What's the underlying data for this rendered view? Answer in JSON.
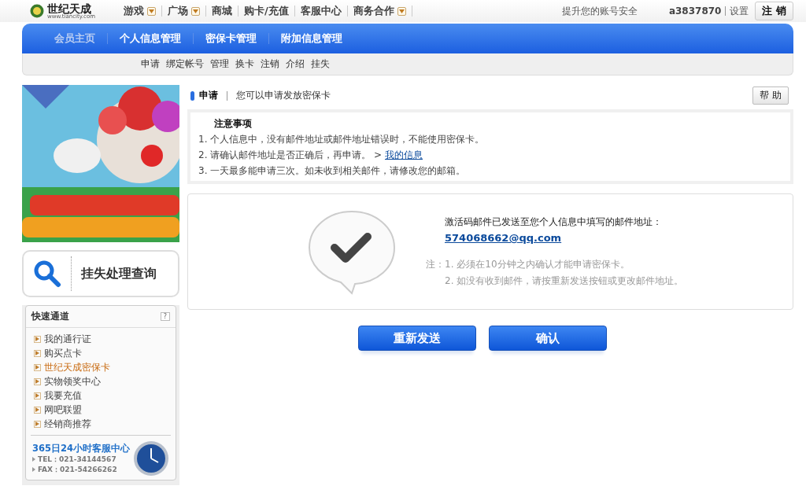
{
  "header": {
    "logo": {
      "name": "世纪天成",
      "url": "www.tiancity.com"
    },
    "nav": [
      {
        "label": "游戏",
        "dropdown": true
      },
      {
        "label": "广场",
        "dropdown": true
      },
      {
        "label": "商城",
        "dropdown": false
      },
      {
        "label": "购卡/充值",
        "dropdown": false
      },
      {
        "label": "客服中心",
        "dropdown": false
      },
      {
        "label": "商务合作",
        "dropdown": true
      }
    ],
    "security_link": "提升您的账号安全",
    "username": "a3837870",
    "settings": "设置",
    "logout": "注 销"
  },
  "main_tabs": [
    "会员主页",
    "个人信息管理",
    "密保卡管理",
    "附加信息管理"
  ],
  "sub_tabs": [
    "申请",
    "绑定帐号",
    "管理",
    "换卡",
    "注销",
    "介绍",
    "挂失"
  ],
  "sidebar": {
    "loss_query": "挂失处理查询",
    "quick": {
      "title": "快速通道",
      "help": "?",
      "items": [
        {
          "label": "我的通行证",
          "selected": false
        },
        {
          "label": "购买点卡",
          "selected": false
        },
        {
          "label": "世纪天成密保卡",
          "selected": true
        },
        {
          "label": "实物领奖中心",
          "selected": false
        },
        {
          "label": "我要充值",
          "selected": false
        },
        {
          "label": "网吧联盟",
          "selected": false
        },
        {
          "label": "经销商推荐",
          "selected": false
        }
      ]
    },
    "service": {
      "title": "365日24小时客服中心",
      "lines": [
        "TEL：021-34144567",
        "FAX：021-54266262"
      ]
    }
  },
  "content": {
    "title": "申请",
    "subtitle": "您可以申请发放密保卡",
    "help_button": "帮 助",
    "notice": {
      "title": "注意事项",
      "items": [
        {
          "text": "1. 个人信息中，没有邮件地址或邮件地址错误时，不能使用密保卡。"
        },
        {
          "text": "2. 请确认邮件地址是否正确后，再申请。 >",
          "link": "我的信息"
        },
        {
          "text": "3. 一天最多能申请三次。如未收到相关邮件，请修改您的邮箱。"
        }
      ]
    },
    "result": {
      "message": "激活码邮件已发送至您个人信息中填写的邮件地址：",
      "email": "574068662@qq.com",
      "note_label": "注：",
      "notes": [
        "1. 必须在10分钟之内确认才能申请密保卡。",
        "2. 如没有收到邮件，请按重新发送按钮或更改邮件地址。"
      ]
    },
    "buttons": [
      "重新发送",
      "确认"
    ]
  }
}
